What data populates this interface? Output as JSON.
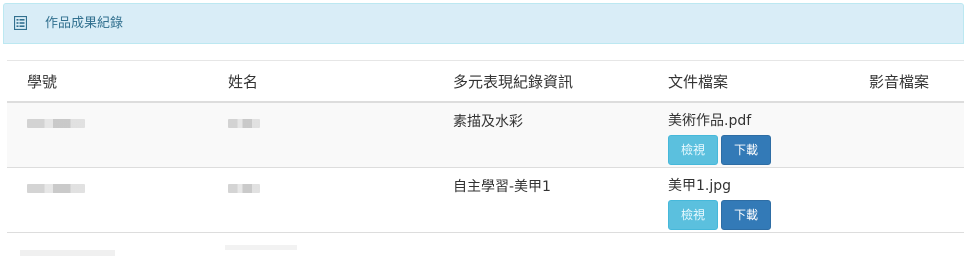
{
  "panel": {
    "title": "作品成果紀錄",
    "icon": "list-icon",
    "accent_color": "#d9edf7"
  },
  "table": {
    "headers": [
      "學號",
      "姓名",
      "多元表現紀錄資訊",
      "文件檔案",
      "影音檔案"
    ],
    "rows": [
      {
        "record_info": "素描及水彩",
        "document": "美術作品.pdf",
        "view_label": "檢視",
        "download_label": "下載"
      },
      {
        "record_info": "自主學習-美甲1",
        "document": "美甲1.jpg",
        "view_label": "檢視",
        "download_label": "下載"
      }
    ]
  },
  "colors": {
    "view_button": "#5bc0de",
    "download_button": "#337ab7"
  }
}
